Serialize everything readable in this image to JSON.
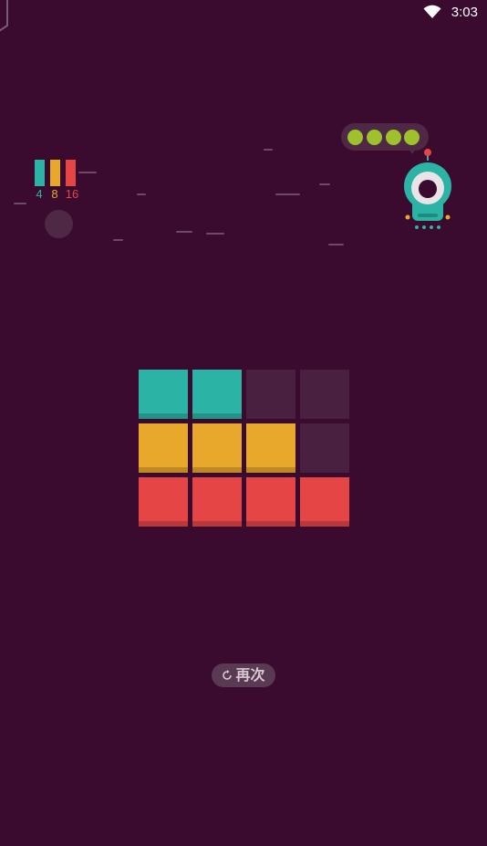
{
  "status_bar": {
    "time": "3:03",
    "icons": [
      "wifi-icon"
    ]
  },
  "legend": {
    "items": [
      {
        "label": "4",
        "color": "#2bb3a5"
      },
      {
        "label": "8",
        "color": "#e8a82b"
      },
      {
        "label": "16",
        "color": "#e54545"
      }
    ]
  },
  "speech_bubble": {
    "dot_count": 4,
    "dot_color": "#9dc22b"
  },
  "board": {
    "rows": [
      [
        "#2bb3a5",
        "#2bb3a5",
        null,
        null
      ],
      [
        "#e8a82b",
        "#e8a82b",
        "#e8a82b",
        null
      ],
      [
        "#e54545",
        "#e54545",
        "#e54545",
        "#e54545"
      ]
    ],
    "empty_color": "#4a2040"
  },
  "retry_button": {
    "label": "再次",
    "icon": "refresh-icon"
  },
  "colors": {
    "background": "#3a0b2f",
    "teal": "#2bb3a5",
    "yellow": "#e8a82b",
    "red": "#e54545",
    "robot_body": "#2bb3a5"
  }
}
